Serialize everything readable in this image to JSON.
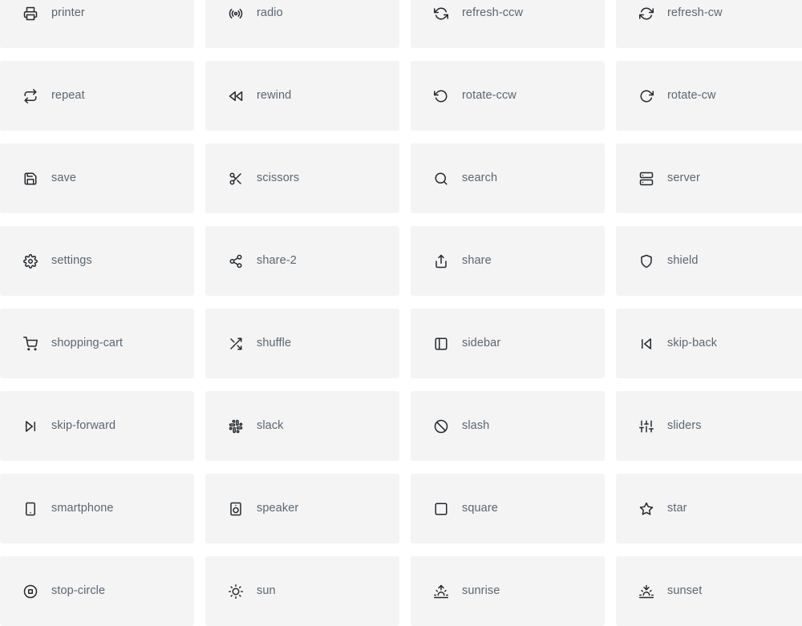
{
  "page": {
    "kind": "icon-gallery",
    "columns": 4,
    "card_background": "#f4f4f4",
    "label_color": "#5a6673",
    "icon_color": "#24292e",
    "page_background": "#ffffff"
  },
  "icons": [
    {
      "name": "printer",
      "label": "printer",
      "glyph": "printer"
    },
    {
      "name": "radio",
      "label": "radio",
      "glyph": "radio"
    },
    {
      "name": "refresh-ccw",
      "label": "refresh-ccw",
      "glyph": "refresh-ccw"
    },
    {
      "name": "refresh-cw",
      "label": "refresh-cw",
      "glyph": "refresh-cw"
    },
    {
      "name": "repeat",
      "label": "repeat",
      "glyph": "repeat"
    },
    {
      "name": "rewind",
      "label": "rewind",
      "glyph": "rewind"
    },
    {
      "name": "rotate-ccw",
      "label": "rotate-ccw",
      "glyph": "rotate-ccw"
    },
    {
      "name": "rotate-cw",
      "label": "rotate-cw",
      "glyph": "rotate-cw"
    },
    {
      "name": "save",
      "label": "save",
      "glyph": "save"
    },
    {
      "name": "scissors",
      "label": "scissors",
      "glyph": "scissors"
    },
    {
      "name": "search",
      "label": "search",
      "glyph": "search"
    },
    {
      "name": "server",
      "label": "server",
      "glyph": "server"
    },
    {
      "name": "settings",
      "label": "settings",
      "glyph": "settings"
    },
    {
      "name": "share-2",
      "label": "share-2",
      "glyph": "share-2"
    },
    {
      "name": "share",
      "label": "share",
      "glyph": "share"
    },
    {
      "name": "shield",
      "label": "shield",
      "glyph": "shield"
    },
    {
      "name": "shopping-cart",
      "label": "shopping-cart",
      "glyph": "shopping-cart"
    },
    {
      "name": "shuffle",
      "label": "shuffle",
      "glyph": "shuffle"
    },
    {
      "name": "sidebar",
      "label": "sidebar",
      "glyph": "sidebar"
    },
    {
      "name": "skip-back",
      "label": "skip-back",
      "glyph": "skip-back"
    },
    {
      "name": "skip-forward",
      "label": "skip-forward",
      "glyph": "skip-forward"
    },
    {
      "name": "slack",
      "label": "slack",
      "glyph": "slack"
    },
    {
      "name": "slash",
      "label": "slash",
      "glyph": "slash"
    },
    {
      "name": "sliders",
      "label": "sliders",
      "glyph": "sliders"
    },
    {
      "name": "smartphone",
      "label": "smartphone",
      "glyph": "smartphone"
    },
    {
      "name": "speaker",
      "label": "speaker",
      "glyph": "speaker"
    },
    {
      "name": "square",
      "label": "square",
      "glyph": "square"
    },
    {
      "name": "star",
      "label": "star",
      "glyph": "star"
    },
    {
      "name": "stop-circle",
      "label": "stop-circle",
      "glyph": "stop-circle"
    },
    {
      "name": "sun",
      "label": "sun",
      "glyph": "sun"
    },
    {
      "name": "sunrise",
      "label": "sunrise",
      "glyph": "sunrise"
    },
    {
      "name": "sunset",
      "label": "sunset",
      "glyph": "sunset"
    }
  ]
}
